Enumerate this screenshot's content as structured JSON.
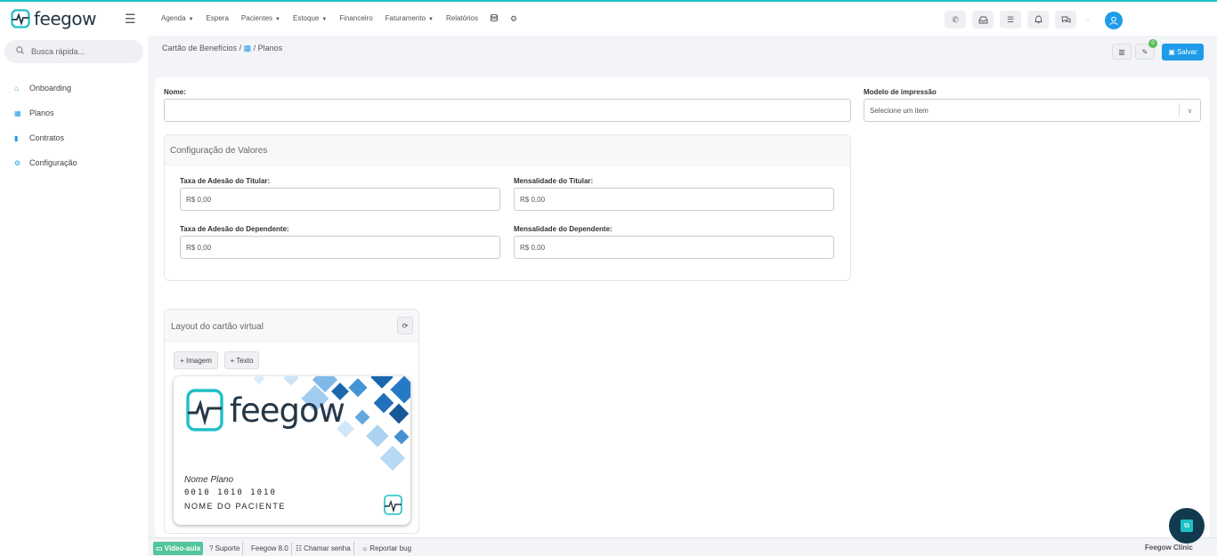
{
  "brand": {
    "name": "feegow",
    "accent": "#1e9be9",
    "logo_teal": "#1ec0c6"
  },
  "nav": {
    "items": [
      {
        "label": "Agenda",
        "caret": true
      },
      {
        "label": "Espera",
        "caret": false
      },
      {
        "label": "Pacientes",
        "caret": true
      },
      {
        "label": "Estoque",
        "caret": true
      },
      {
        "label": "Financeiro",
        "caret": false
      },
      {
        "label": "Faturamento",
        "caret": true
      },
      {
        "label": "Relatórios",
        "caret": false
      }
    ],
    "icons": [
      "database-icon",
      "gear-icon"
    ],
    "right_icons": [
      "phone-icon",
      "inbox-icon",
      "list-icon",
      "bell-icon",
      "chat-icon"
    ]
  },
  "sidebar": {
    "search_placeholder": "Busca rápida...",
    "items": [
      {
        "label": "Onboarding",
        "icon": "home-icon"
      },
      {
        "label": "Planos",
        "icon": "table-icon"
      },
      {
        "label": "Contratos",
        "icon": "file-icon"
      },
      {
        "label": "Configuração",
        "icon": "gear-icon"
      }
    ]
  },
  "breadcrumb": {
    "root": "Cartão de Benefícios",
    "sep": "/",
    "current": "Planos"
  },
  "header_buttons": {
    "badge": "0",
    "save": "Salvar"
  },
  "form": {
    "name_label": "Nome:",
    "name_value": "",
    "print_model_label": "Modelo de impressão",
    "print_model_value": "Selecione um item",
    "values_section_title": "Configuração de Valores",
    "fields": [
      {
        "label": "Taxa de Adesão do Titular:",
        "value": "R$ 0,00"
      },
      {
        "label": "Mensalidade do Titular:",
        "value": "R$ 0,00"
      },
      {
        "label": "Taxa de Adesão do Dependente:",
        "value": "R$ 0,00"
      },
      {
        "label": "Mensalidade do Dependente:",
        "value": "R$ 0,00"
      }
    ]
  },
  "card_layout": {
    "title": "Layout do cartão virtual",
    "add_image": "+ Imagem",
    "add_text": "+ Texto",
    "card": {
      "logo_text": "feegow",
      "plan_name": "Nome Plano",
      "number": "0010 1010 1010",
      "patient_name": "NOME DO PACIENTE"
    }
  },
  "footer": {
    "items": [
      "Vídeo-aula",
      "Suporte",
      "Feegow 8.0",
      "Chamar senha",
      "Reportar bug"
    ],
    "right": "Feegow Clinic"
  }
}
